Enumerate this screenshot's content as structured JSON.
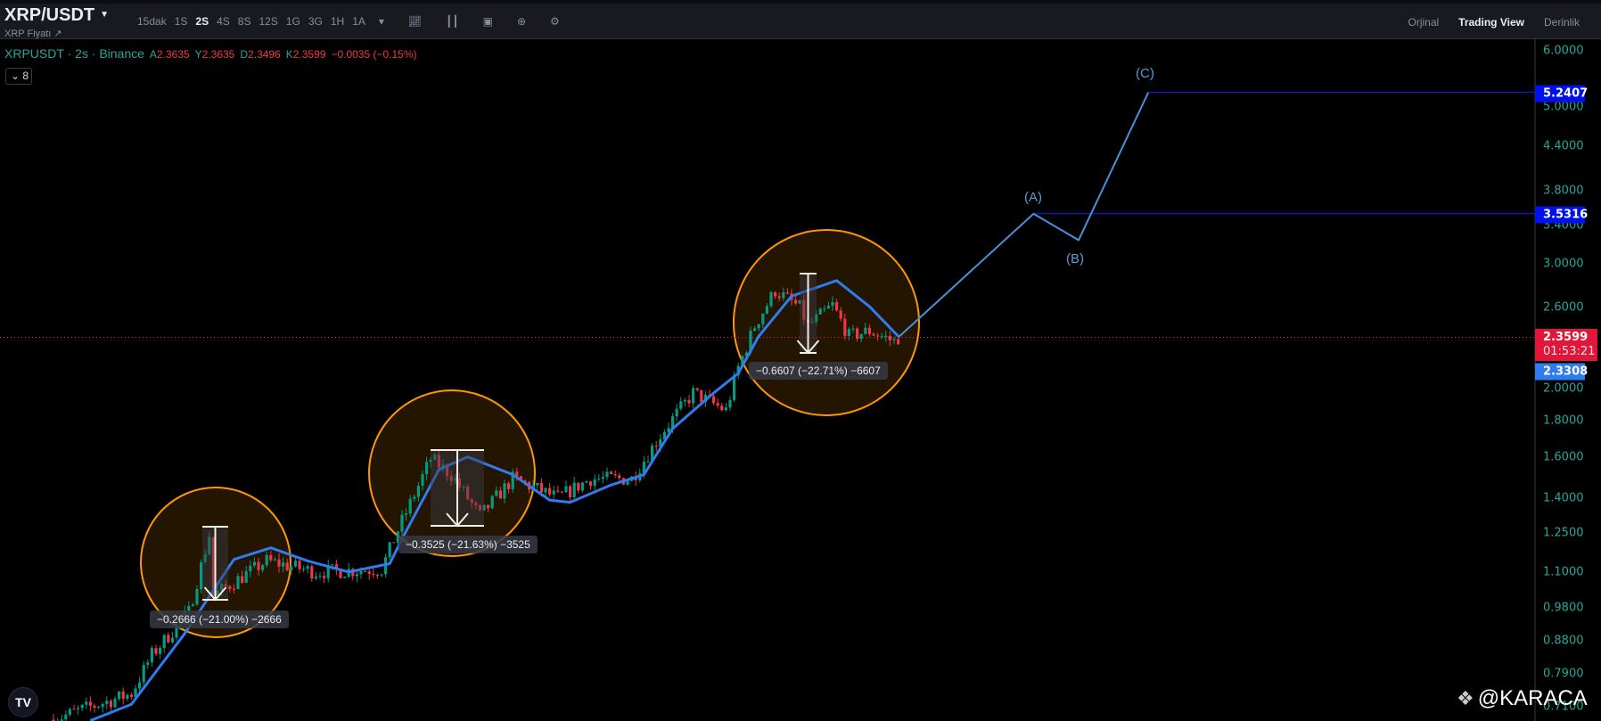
{
  "header": {
    "title": "XRP/USDT",
    "subtitle": "XRP Fiyatı ↗",
    "intervals": [
      "15dak",
      "1S",
      "2S",
      "4S",
      "8S",
      "12S",
      "1G",
      "3G",
      "1H",
      "1A"
    ],
    "active_interval": "2S",
    "views": [
      "Orjinal",
      "Trading View",
      "Derinlik"
    ],
    "active_view": "Trading View",
    "tools": [
      "more-intervals-icon",
      "indicators-icon",
      "chart-type-icon",
      "screenshot-icon",
      "add-icon",
      "settings-icon"
    ]
  },
  "legend": {
    "symbol": "XRPUSDT · 2s · Binance",
    "open_label": "A",
    "open": "2.3635",
    "high_label": "Y",
    "high": "2.3635",
    "low_label": "D",
    "low": "2.3496",
    "close_label": "K",
    "close": "2.3599",
    "change": "−0.0035 (−0.15%)",
    "indicator_count": "8"
  },
  "axis": {
    "ticks": [
      "6.0000",
      "5.0000",
      "4.4000",
      "3.8000",
      "3.4000",
      "3.0000",
      "2.6000",
      "2.0000",
      "1.8000",
      "1.6000",
      "1.4000",
      "1.2500",
      "1.1000",
      "0.9800",
      "0.8800",
      "0.7900",
      "0.7100"
    ],
    "tick_values": [
      6,
      5,
      4.4,
      3.8,
      3.4,
      3.0,
      2.6,
      2.0,
      1.8,
      1.6,
      1.4,
      1.25,
      1.1,
      0.98,
      0.88,
      0.79,
      0.71
    ],
    "target_c": "5.2407",
    "target_a": "3.5316",
    "current_price": "2.3599",
    "countdown": "01:53:21",
    "ma_value": "2.3308"
  },
  "measures": [
    {
      "label": "−0.2666 (−21.00%) −2666"
    },
    {
      "label": "−0.3525 (−21.63%) −3525"
    },
    {
      "label": "−0.6607 (−22.71%) −6607"
    }
  ],
  "waves": {
    "a": "(A)",
    "b": "(B)",
    "c": "(C)"
  },
  "watermark": "@KARACA",
  "colors": {
    "up": "#089981",
    "down": "#f23645",
    "ma": "#2f7bf0",
    "circle": "#ff9800",
    "target_line": "#1a1aff",
    "projection": "#4a90d9"
  },
  "chart_data": {
    "type": "candlestick",
    "scale": "log",
    "ylim": [
      0.68,
      6.3
    ],
    "price_path": [
      [
        0,
        0.68
      ],
      [
        6,
        0.7
      ],
      [
        19,
        0.74
      ],
      [
        24,
        0.84
      ],
      [
        33,
        0.965
      ],
      [
        38,
        1.24
      ],
      [
        39,
        1.02
      ],
      [
        52,
        1.14
      ],
      [
        64,
        1.1
      ],
      [
        80,
        1.11
      ],
      [
        84,
        1.26
      ],
      [
        92,
        1.59
      ],
      [
        97,
        1.51
      ],
      [
        104,
        1.32
      ],
      [
        112,
        1.49
      ],
      [
        123,
        1.4
      ],
      [
        131,
        1.49
      ],
      [
        141,
        1.49
      ],
      [
        149,
        1.75
      ],
      [
        156,
        1.97
      ],
      [
        164,
        1.86
      ],
      [
        167,
        2.14
      ],
      [
        171,
        2.45
      ],
      [
        176,
        2.75
      ],
      [
        182,
        2.6
      ],
      [
        184,
        2.45
      ],
      [
        190,
        2.62
      ],
      [
        194,
        2.37
      ],
      [
        199,
        2.41
      ],
      [
        205,
        2.33
      ],
      [
        206,
        2.36
      ]
    ],
    "ma_path": [
      [
        9,
        0.678
      ],
      [
        19,
        0.715
      ],
      [
        32,
        0.9
      ],
      [
        44,
        1.146
      ],
      [
        53,
        1.19
      ],
      [
        62,
        1.14
      ],
      [
        72,
        1.1
      ],
      [
        82,
        1.13
      ],
      [
        85,
        1.225
      ],
      [
        94,
        1.535
      ],
      [
        101,
        1.6
      ],
      [
        112,
        1.51
      ],
      [
        121,
        1.39
      ],
      [
        126,
        1.38
      ],
      [
        136,
        1.46
      ],
      [
        144,
        1.51
      ],
      [
        151,
        1.754
      ],
      [
        161,
        1.97
      ],
      [
        167,
        2.1
      ],
      [
        172,
        2.37
      ],
      [
        180,
        2.7
      ],
      [
        191,
        2.84
      ],
      [
        199,
        2.61
      ],
      [
        206,
        2.37
      ]
    ],
    "projection": [
      [
        206,
        2.36
      ],
      [
        239,
        3.53
      ],
      [
        250,
        3.24
      ],
      [
        267,
        5.24
      ]
    ],
    "current_price": 2.3599,
    "levels": [
      5.2407,
      3.5316
    ]
  }
}
